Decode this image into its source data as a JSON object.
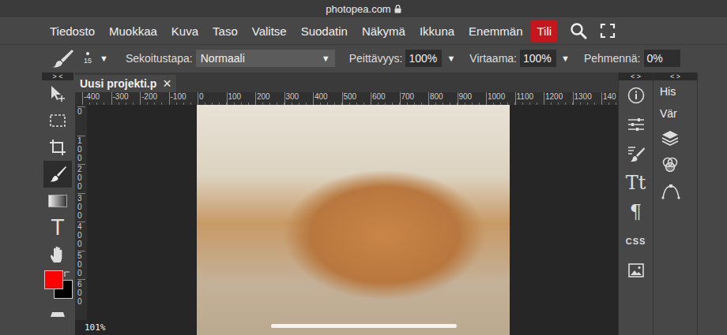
{
  "browser": {
    "url": "photopea.com"
  },
  "menu": [
    {
      "label": "Tiedosto",
      "selected": false
    },
    {
      "label": "Muokkaa",
      "selected": false
    },
    {
      "label": "Kuva",
      "selected": false
    },
    {
      "label": "Taso",
      "selected": false
    },
    {
      "label": "Valitse",
      "selected": false
    },
    {
      "label": "Suodatin",
      "selected": false
    },
    {
      "label": "Näkymä",
      "selected": false
    },
    {
      "label": "Ikkuna",
      "selected": false
    },
    {
      "label": "Enemmän",
      "selected": false
    },
    {
      "label": "Tili",
      "selected": true
    }
  ],
  "options": {
    "brush_size": "15",
    "arrow": "▼",
    "blend_label": "Sekoitustapa:",
    "blend_value": "Normaali",
    "opacity_label": "Peittävyys:",
    "opacity_value": "100%",
    "flow_label": "Virtaama:",
    "flow_value": "100%",
    "smooth_label": "Pehmennä:",
    "smooth_value": "0%"
  },
  "toolbar": {
    "collapse": "> <",
    "tools": [
      {
        "kind": "move",
        "selected": false
      },
      {
        "kind": "marquee",
        "selected": false
      },
      {
        "kind": "crop",
        "selected": false
      },
      {
        "kind": "brush",
        "selected": true
      },
      {
        "kind": "gradient",
        "selected": false
      },
      {
        "kind": "text",
        "label": "T",
        "selected": false
      },
      {
        "kind": "hand",
        "selected": false
      }
    ],
    "foreground": {
      "color": "#ff0000"
    },
    "background": {
      "color": "#000000"
    },
    "bottom_tool": {
      "kind": "eraser",
      "selected": false
    }
  },
  "document": {
    "tab": "Uusi projekti.p",
    "close": "×",
    "zoom": "101%"
  },
  "rulers": {
    "top": [
      "-400",
      "-300",
      "-200",
      "-100",
      "0",
      "100",
      "200",
      "300",
      "400",
      "500",
      "600",
      "700",
      "800",
      "900",
      "1000",
      "1100",
      "1200",
      "1300",
      "140"
    ],
    "left": [
      "0",
      "100",
      "200",
      "300",
      "400",
      "500",
      "600"
    ]
  },
  "panel1": {
    "collapse": "< >",
    "items": [
      {
        "kind": "info"
      },
      {
        "kind": "adjust"
      },
      {
        "kind": "brush"
      },
      {
        "kind": "text",
        "label": "Tt"
      },
      {
        "kind": "text",
        "label": "¶"
      },
      {
        "kind": "css",
        "label": "CSS"
      },
      {
        "kind": "image"
      }
    ]
  },
  "panel2": {
    "collapse": "< >",
    "tabs": [
      "His",
      "Vär"
    ],
    "items": [
      {
        "kind": "layers"
      },
      {
        "kind": "channels"
      },
      {
        "kind": "paths"
      }
    ]
  }
}
